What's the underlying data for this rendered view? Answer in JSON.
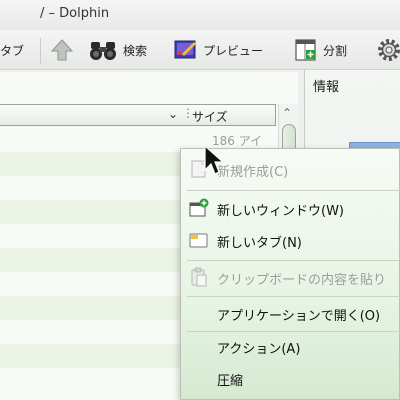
{
  "window": {
    "title": "/ – Dolphin"
  },
  "toolbar": {
    "partial_tab_label": "タブ",
    "search_label": "検索",
    "preview_label": "プレビュー",
    "split_label": "分割"
  },
  "file_view": {
    "size_column": "サイズ",
    "first_size": "186 アイ"
  },
  "info_panel": {
    "title": "情報"
  },
  "context_menu": {
    "items": [
      {
        "label": "新規作成(C)",
        "icon": "new-document-icon",
        "enabled": false
      },
      {
        "label": "新しいウィンドウ(W)",
        "icon": "new-window-icon",
        "enabled": true
      },
      {
        "label": "新しいタブ(N)",
        "icon": "new-tab-icon",
        "enabled": true
      },
      {
        "label": "クリップボードの内容を貼り",
        "icon": "paste-icon",
        "enabled": false
      },
      {
        "label": "アプリケーションで開く(O)",
        "icon": "",
        "enabled": true
      },
      {
        "label": "アクション(A)",
        "icon": "",
        "enabled": true
      },
      {
        "label": "圧縮",
        "icon": "",
        "enabled": true
      }
    ]
  },
  "colors": {
    "menu_bg": "#e7f4e4",
    "row_alt": "#eaf3e6",
    "accent_green": "#2f9e3a",
    "info_preview": "#8fb1e0"
  }
}
